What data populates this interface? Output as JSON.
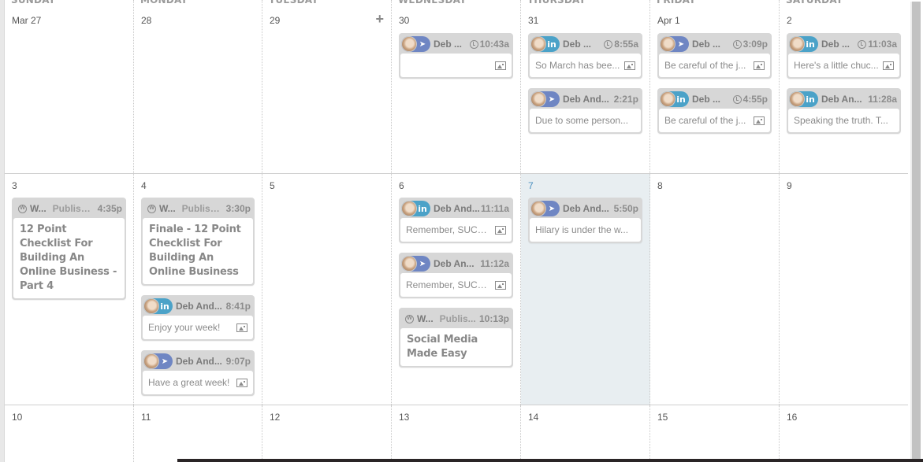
{
  "weekdays": [
    "SUNDAY",
    "MONDAY",
    "TUESDAY",
    "WEDNESDAY",
    "THURSDAY",
    "FRIDAY",
    "SATURDAY"
  ],
  "weeks": [
    {
      "days": [
        {
          "date": "Mar 27",
          "posts": []
        },
        {
          "date": "28",
          "posts": []
        },
        {
          "date": "29",
          "add_label": "+",
          "posts": []
        },
        {
          "date": "30",
          "posts": [
            {
              "network": "share",
              "author": "Deb ...",
              "time": "10:43a",
              "scheduled": true,
              "text": "",
              "has_image": true
            }
          ]
        },
        {
          "date": "31",
          "posts": [
            {
              "network": "linkedin",
              "author": "Deb ...",
              "time": "8:55a",
              "scheduled": true,
              "text": "So March has bee...",
              "has_image": true
            },
            {
              "network": "share",
              "author": "Deb And...",
              "time": "2:21p",
              "scheduled": false,
              "text": "Due to some person...",
              "has_image": false
            }
          ]
        },
        {
          "date": "Apr 1",
          "posts": [
            {
              "network": "share",
              "author": "Deb ...",
              "time": "3:09p",
              "scheduled": true,
              "text": "Be careful of the j...",
              "has_image": true
            },
            {
              "network": "linkedin",
              "author": "Deb ...",
              "time": "4:55p",
              "scheduled": true,
              "text": "Be careful of the j...",
              "has_image": true
            }
          ]
        },
        {
          "date": "2",
          "posts": [
            {
              "network": "linkedin",
              "author": "Deb ...",
              "time": "11:03a",
              "scheduled": true,
              "text": "Here's a little chuc...",
              "has_image": true
            },
            {
              "network": "linkedin",
              "author": "Deb An...",
              "time": "11:28a",
              "scheduled": false,
              "text": "Speaking the truth. T...",
              "has_image": false
            }
          ]
        }
      ]
    },
    {
      "days": [
        {
          "date": "3",
          "posts": [
            {
              "network": "wordpress",
              "source": "W...",
              "status": "Publish...",
              "time": "4:35p",
              "title": "12 Point Checklist For Building An Online Business - Part 4"
            }
          ]
        },
        {
          "date": "4",
          "posts": [
            {
              "network": "wordpress",
              "source": "W...",
              "status": "Publish...",
              "time": "3:30p",
              "title": "Finale - 12 Point Checklist For Building An Online Business"
            },
            {
              "network": "linkedin",
              "author": "Deb And...",
              "time": "8:41p",
              "scheduled": false,
              "text": "Enjoy your week!",
              "has_image": true
            },
            {
              "network": "share",
              "author": "Deb And...",
              "time": "9:07p",
              "scheduled": false,
              "text": "Have a great week!",
              "has_image": true
            }
          ]
        },
        {
          "date": "5",
          "posts": []
        },
        {
          "date": "6",
          "posts": [
            {
              "network": "linkedin",
              "author": "Deb And...",
              "time": "11:11a",
              "scheduled": false,
              "text": "Remember, SUCC...",
              "has_image": true
            },
            {
              "network": "share",
              "author": "Deb An...",
              "time": "11:12a",
              "scheduled": false,
              "text": "Remember, SUCC...",
              "has_image": true
            },
            {
              "network": "wordpress",
              "source": "W...",
              "status": "Publis...",
              "time": "10:13p",
              "title": "Social Media Made Easy"
            }
          ]
        },
        {
          "date": "7",
          "today": true,
          "posts": [
            {
              "network": "share",
              "author": "Deb And...",
              "time": "5:50p",
              "scheduled": false,
              "text": "Hilary is under the w...",
              "has_image": false
            }
          ]
        },
        {
          "date": "8",
          "posts": []
        },
        {
          "date": "9",
          "posts": []
        }
      ]
    },
    {
      "days": [
        {
          "date": "10",
          "posts": []
        },
        {
          "date": "11",
          "posts": []
        },
        {
          "date": "12",
          "posts": []
        },
        {
          "date": "13",
          "posts": []
        },
        {
          "date": "14",
          "posts": []
        },
        {
          "date": "15",
          "posts": []
        },
        {
          "date": "16",
          "posts": []
        }
      ]
    }
  ],
  "icons": {
    "linkedin": "in",
    "share": "➤",
    "wordpress": "W",
    "add": "+"
  },
  "colors": {
    "linkedin": "#4ba2c8",
    "share": "#6f86c3",
    "today_bg": "#e8eef1",
    "today_date": "#4a90c0"
  }
}
